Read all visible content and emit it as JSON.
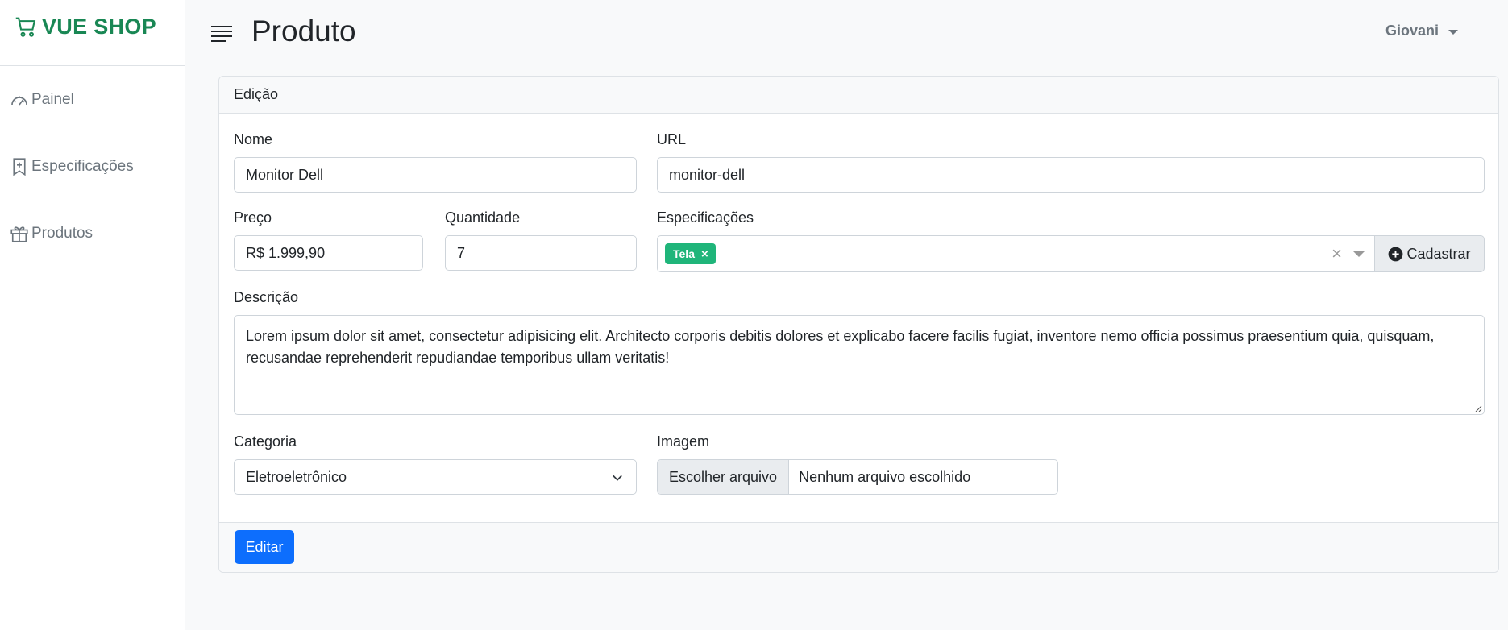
{
  "brand": {
    "name": "VUE SHOP",
    "icon": "cart-icon",
    "color": "#198754"
  },
  "sidebar": {
    "items": [
      {
        "label": "Painel",
        "icon": "speedometer-icon"
      },
      {
        "label": "Especificações",
        "icon": "bookmark-plus-icon"
      },
      {
        "label": "Produtos",
        "icon": "gift-icon"
      }
    ]
  },
  "header": {
    "title": "Produto",
    "user": "Giovani"
  },
  "card": {
    "title": "Edição",
    "fields": {
      "nome": {
        "label": "Nome",
        "value": "Monitor Dell"
      },
      "url": {
        "label": "URL",
        "value": "monitor-dell"
      },
      "preco": {
        "label": "Preço",
        "value": "R$ 1.999,90"
      },
      "quantidade": {
        "label": "Quantidade",
        "value": "7"
      },
      "especificacoes": {
        "label": "Especificações",
        "tags": [
          "Tela"
        ],
        "clear": "×",
        "add_button": "Cadastrar"
      },
      "descricao": {
        "label": "Descrição",
        "value": "Lorem ipsum dolor sit amet, consectetur adipisicing elit. Architecto corporis debitis dolores et explicabo facere facilis fugiat, inventore nemo officia possimus praesentium quia, quisquam, recusandae reprehenderit repudiandae temporibus ullam veritatis!"
      },
      "categoria": {
        "label": "Categoria",
        "selected": "Eletroeletrônico"
      },
      "imagem": {
        "label": "Imagem",
        "button": "Escolher arquivo",
        "status": "Nenhum arquivo escolhido"
      }
    },
    "submit_label": "Editar"
  },
  "colors": {
    "primary": "#0d6efd",
    "tag": "#1fb57a",
    "muted": "#6c757d"
  }
}
